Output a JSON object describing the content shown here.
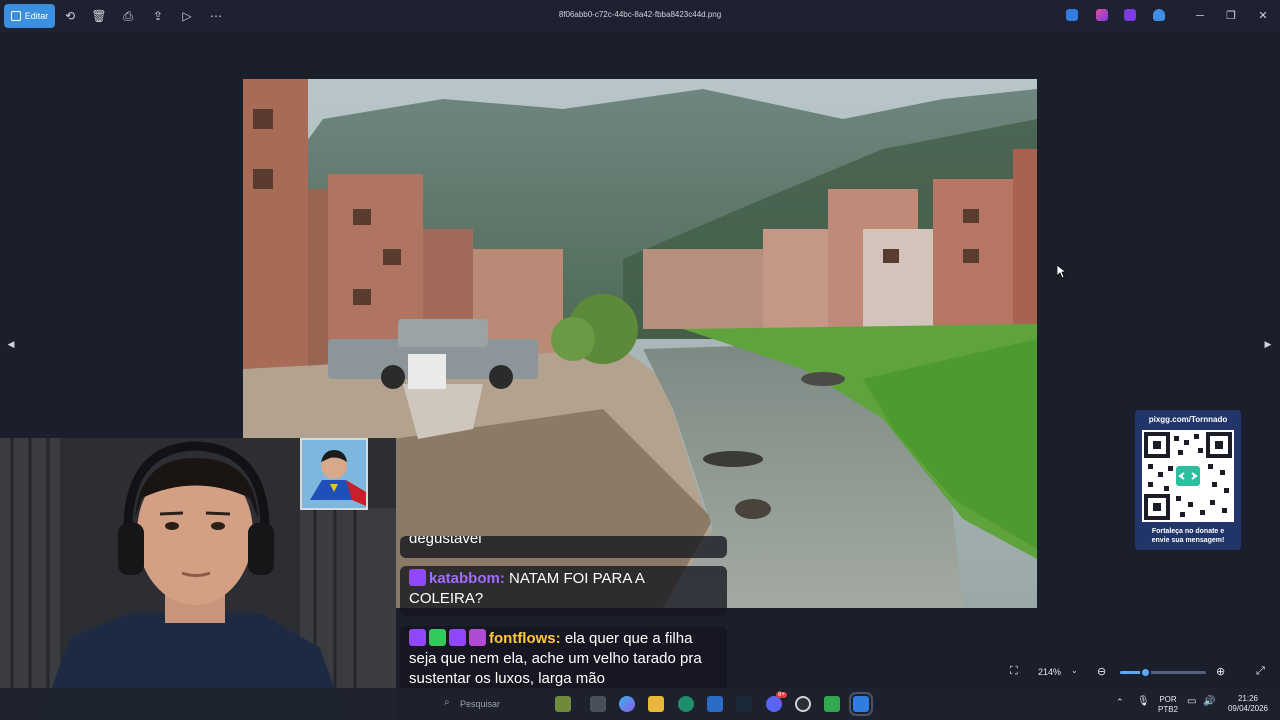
{
  "toolbar": {
    "edit_label": "Editar",
    "filename": "8f06abb0-c72c-44bc-8a42-fbba8423c44d.png",
    "icons": [
      "rotate-icon",
      "delete-icon",
      "print-icon",
      "share-icon",
      "slideshow-icon",
      "more-icon"
    ]
  },
  "qr": {
    "url": "pixgg.com/Tornnado",
    "footer_line1": "Fortaleça no donate e",
    "footer_line2": "envie sua mensagem!"
  },
  "chat": {
    "partial_text": "degustavel",
    "msg1": {
      "user": "katabbom:",
      "text": "NATAM FOI PARA A COLEIRA?"
    },
    "msg2": {
      "user": "fontflows:",
      "text": "ela quer que a filha seja que nem ela, ache um velho tarado pra sustentar os luxos, larga mão"
    }
  },
  "zoom": {
    "level": "214%",
    "slider_fraction": 0.3
  },
  "taskbar": {
    "search_placeholder": "Pesquisar",
    "lang_line1": "POR",
    "lang_line2": "PTB2",
    "time": "21:26",
    "date": "09/04/2026",
    "discord_badge": "9+"
  },
  "colors": {
    "accent": "#3a8fe0",
    "viewer_bg": "#1b1f2b",
    "twitch_purple": "#a16bff",
    "chat_gold": "#ffc83d"
  }
}
